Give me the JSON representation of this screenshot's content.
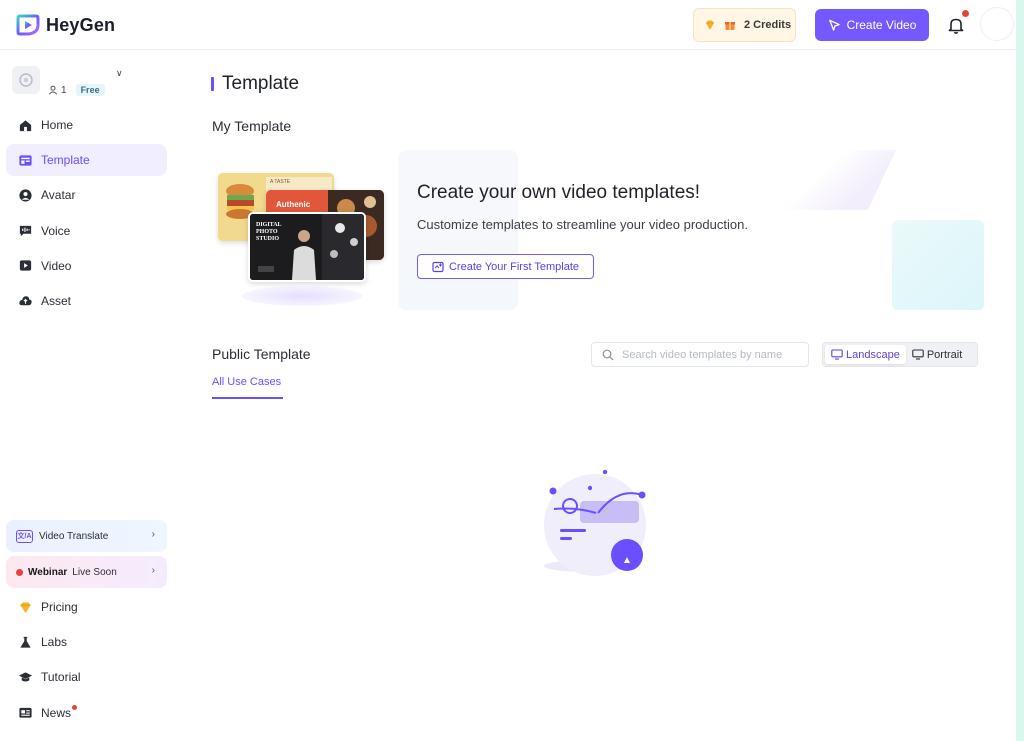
{
  "app": {
    "name": "HeyGen"
  },
  "header": {
    "credits_label": "2 Credits",
    "create_video_label": "Create Video"
  },
  "workspace": {
    "members": "1",
    "plan": "Free"
  },
  "sidebar": {
    "items": [
      {
        "label": "Home",
        "icon": "home-icon"
      },
      {
        "label": "Template",
        "icon": "template-icon",
        "active": true
      },
      {
        "label": "Avatar",
        "icon": "avatar-icon"
      },
      {
        "label": "Voice",
        "icon": "voice-icon"
      },
      {
        "label": "Video",
        "icon": "video-icon"
      },
      {
        "label": "Asset",
        "icon": "asset-icon"
      }
    ],
    "video_translate": {
      "label": "Video Translate",
      "icon_text": "文/A"
    },
    "webinar": {
      "bold": "Webinar",
      "rest": "Live Soon"
    },
    "bottom_items": [
      {
        "label": "Pricing",
        "icon": "diamond-icon"
      },
      {
        "label": "Labs",
        "icon": "flask-icon"
      },
      {
        "label": "Tutorial",
        "icon": "graduation-cap-icon"
      },
      {
        "label": "News",
        "icon": "news-icon"
      }
    ]
  },
  "main": {
    "page_title": "Template",
    "my_template_title": "My Template",
    "hero": {
      "heading": "Create your own video templates!",
      "subtext": "Customize templates to streamline your video production.",
      "button_label": "Create Your First Template",
      "thumb_text_1": "A TASTE",
      "thumb_text_2": "Authenic",
      "thumb_text_3": "DIGITAL PHOTO STUDIO"
    },
    "public_template_title": "Public Template",
    "search_placeholder": "Search video templates by name",
    "orientation": {
      "landscape": "Landscape",
      "portrait": "Portrait",
      "selected": "Landscape"
    },
    "use_case_tab": "All Use Cases"
  },
  "colors": {
    "accent": "#7559ff",
    "active_bg": "#f1eeff",
    "notification": "#e0463f"
  }
}
